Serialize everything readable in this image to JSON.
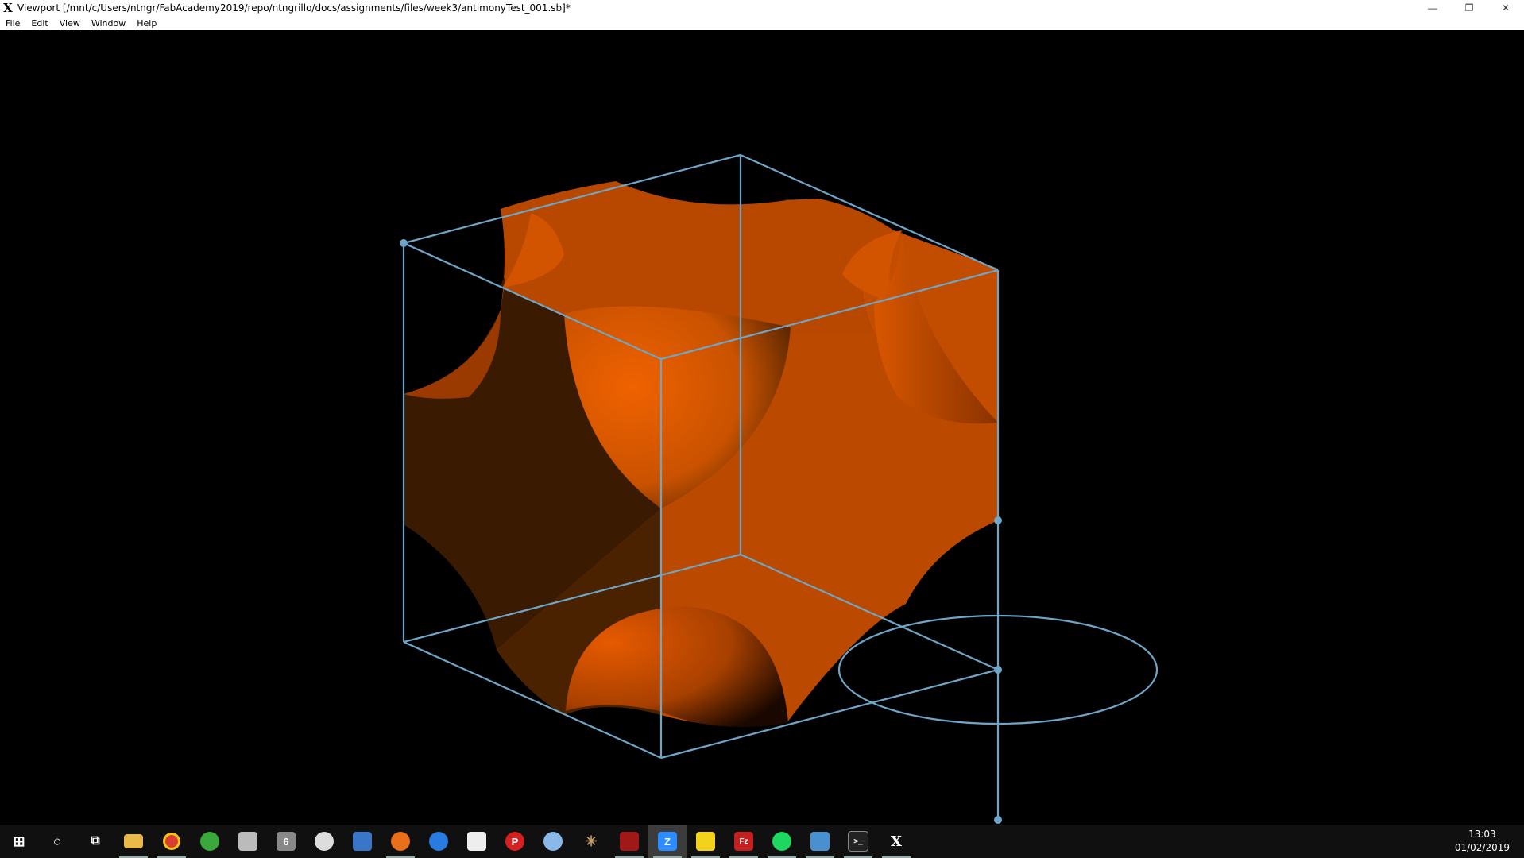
{
  "window": {
    "title": "Viewport [/mnt/c/Users/ntngr/FabAcademy2019/repo/ntngrillo/docs/assignments/files/week3/antimonyTest_001.sb]*",
    "app_icon": "X",
    "minimize": "—",
    "restore": "❐",
    "close": "✕"
  },
  "menu": {
    "file": "File",
    "edit": "Edit",
    "view": "View",
    "window": "Window",
    "help": "Help"
  },
  "colors": {
    "shape_bright": "#e65c00",
    "shape_mid": "#b84800",
    "shape_dark": "#3a1a00",
    "wireframe": "#6fa6c8"
  },
  "taskbar": {
    "icons": [
      {
        "name": "windows-start-icon",
        "glyph": "⊞",
        "color": "#101010"
      },
      {
        "name": "cortana-search-icon",
        "glyph": "○",
        "color": "#101010"
      },
      {
        "name": "task-view-icon",
        "glyph": "⧉",
        "color": "#101010"
      },
      {
        "name": "file-explorer-icon",
        "glyph": "",
        "color": "#e8b84a"
      },
      {
        "name": "chrome-icon",
        "glyph": "",
        "color": "#d93f2e"
      },
      {
        "name": "inkscape-icon",
        "glyph": "",
        "color": "#3aa83a"
      },
      {
        "name": "fusion-icon",
        "glyph": "",
        "color": "#bbbbbb"
      },
      {
        "name": "rhino6-icon",
        "glyph": "6",
        "color": "#888888"
      },
      {
        "name": "paint-icon",
        "glyph": "",
        "color": "#dddddd"
      },
      {
        "name": "network-icon",
        "glyph": "",
        "color": "#3a76c8"
      },
      {
        "name": "firefox-icon",
        "glyph": "",
        "color": "#e8701a"
      },
      {
        "name": "mail-icon",
        "glyph": "",
        "color": "#2a7be0"
      },
      {
        "name": "calendar-icon",
        "glyph": "",
        "color": "#eeeeee"
      },
      {
        "name": "powerpoint-icon",
        "glyph": "P",
        "color": "#d62020"
      },
      {
        "name": "bluetooth-icon",
        "glyph": "",
        "color": "#8ab8e8"
      },
      {
        "name": "molecule-icon",
        "glyph": "✳",
        "color": "#101010"
      },
      {
        "name": "sketch-tool-icon",
        "glyph": "",
        "color": "#a01818"
      },
      {
        "name": "zoom-icon",
        "glyph": "Z",
        "color": "#2d8cff"
      },
      {
        "name": "sticky-notes-icon",
        "glyph": "",
        "color": "#f2d21b"
      },
      {
        "name": "filezilla-icon",
        "glyph": "Fz",
        "color": "#c42020"
      },
      {
        "name": "spotify-icon",
        "glyph": "",
        "color": "#1ed760"
      },
      {
        "name": "photos-icon",
        "glyph": "",
        "color": "#4a90d0"
      },
      {
        "name": "terminal-icon",
        "glyph": ">_",
        "color": "#222222"
      },
      {
        "name": "antimony-icon",
        "glyph": "X",
        "color": "#101010"
      }
    ]
  },
  "clock": {
    "time": "13:03",
    "date": "01/02/2019"
  }
}
